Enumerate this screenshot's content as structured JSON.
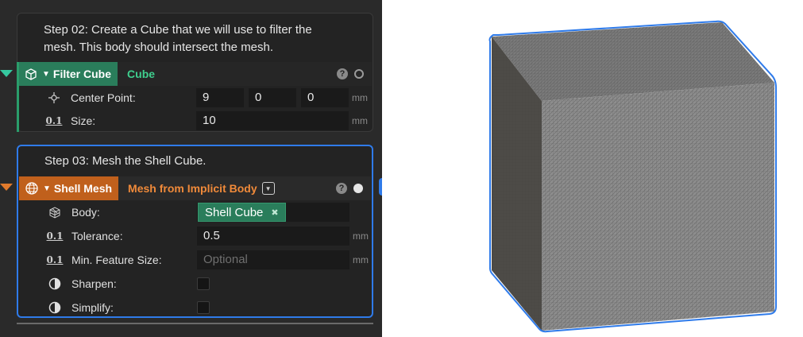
{
  "colors": {
    "panel_bg": "#2a2a2a",
    "filter_accent": "#2a7d5b",
    "shell_accent": "#c0601c",
    "selection_blue": "#2f7bea",
    "shell_type_text": "#f08a3a",
    "filter_type_text": "#3fcf8e"
  },
  "step2": {
    "text": "Step 02: Create a Cube that we will use to filter the mesh. This body should intersect the mesh.",
    "node": {
      "icon": "wire-cube-icon",
      "tag": "Filter Cube",
      "type": "Cube",
      "help": "?"
    },
    "center": {
      "label": "Center Point:",
      "x": "9",
      "y": "0",
      "z": "0",
      "unit": "mm",
      "icon": "crosshair-icon"
    },
    "size": {
      "label": "Size:",
      "value": "10",
      "unit": "mm",
      "icon": "0.1"
    }
  },
  "step3": {
    "text": "Step 03: Mesh the Shell Cube.",
    "node": {
      "icon": "globe-icon",
      "tag": "Shell Mesh",
      "type": "Mesh from Implicit Body",
      "help": "?",
      "add": "+"
    },
    "body": {
      "label": "Body:",
      "value": "Shell Cube",
      "remove": "✖",
      "icon": "mesh-icon"
    },
    "tolerance": {
      "label": "Tolerance:",
      "value": "0.5",
      "unit": "mm",
      "icon": "0.1"
    },
    "min_feature": {
      "label": "Min. Feature Size:",
      "placeholder": "Optional",
      "unit": "mm",
      "icon": "0.1"
    },
    "sharpen": {
      "label": "Sharpen:",
      "checked": false,
      "icon": "half-circle-icon"
    },
    "simplify": {
      "label": "Simplify:",
      "checked": false,
      "icon": "half-circle-icon"
    }
  }
}
